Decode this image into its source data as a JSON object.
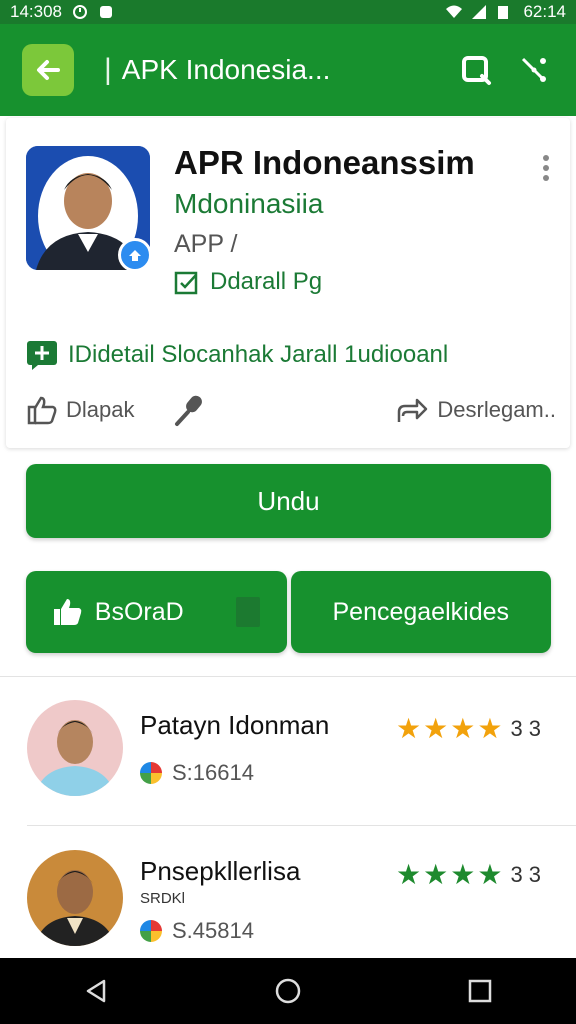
{
  "status_bar": {
    "time": "14:308",
    "battery_text": "62:14"
  },
  "app_bar": {
    "title": "APK Indonesia..."
  },
  "app": {
    "name": "APR Indoneanssim",
    "developer": "Mdoninasiia",
    "category": "APP /",
    "editor_label": "Ddarall Pg",
    "detail_text": "IDidetail Slocanhak Jarall 1udiooanl"
  },
  "actions": {
    "like_label": "Dlapak",
    "share_label": "Desrlegam.."
  },
  "buttons": {
    "install_label": "Undu",
    "left_label": "BsOraD",
    "right_label": "Pencegaelkides"
  },
  "reviews": [
    {
      "name": "Patayn Idonman",
      "subtitle": "",
      "meta": "S:16614",
      "rating": "3 3",
      "star_color": "#f2a20c"
    },
    {
      "name": "Pnsepkllerlisa",
      "subtitle": "SRDKl",
      "meta": "S.45814",
      "rating": "3 3",
      "star_color": "#1e8a2e"
    }
  ],
  "colors": {
    "primary": "#17912e",
    "accent_green_text": "#1b7a35",
    "back_button": "#7cc83a",
    "status_bar": "#1a7a2c"
  },
  "icons": [
    "back-arrow-icon",
    "search-icon",
    "share-icon",
    "more-vert-icon",
    "verified-icon",
    "editor-check-icon",
    "detail-plus-icon",
    "thumb-up-icon",
    "mic-icon",
    "share-arrow-icon",
    "nav-back-icon",
    "nav-home-icon",
    "nav-recents-icon"
  ]
}
